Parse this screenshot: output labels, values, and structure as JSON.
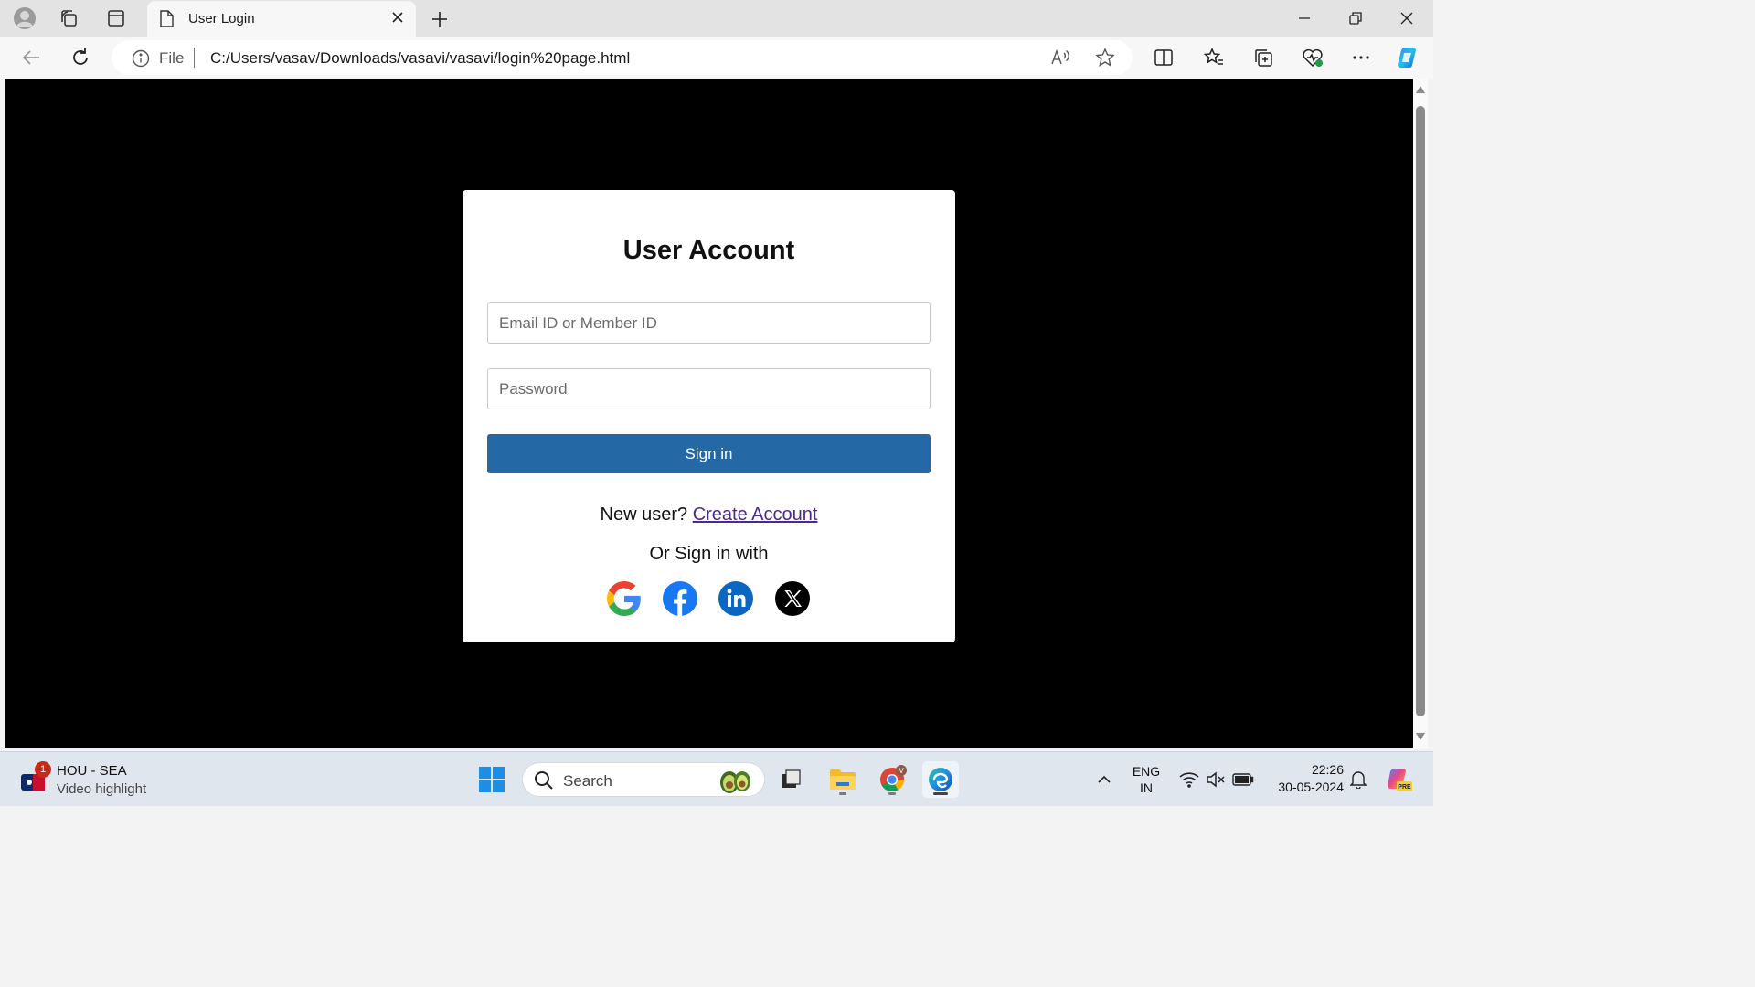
{
  "browser": {
    "tab": {
      "title": "User Login"
    },
    "address": {
      "scheme": "File",
      "url": "C:/Users/vasav/Downloads/vasavi/vasavi/login%20page.html"
    }
  },
  "login": {
    "title": "User Account",
    "email_placeholder": "Email ID or Member ID",
    "password_placeholder": "Password",
    "signin_label": "Sign in",
    "new_user_text": "New user?",
    "create_account_link": "Create Account",
    "or_sign_in_text": "Or Sign in with",
    "social": [
      "google-icon",
      "facebook-icon",
      "linkedin-icon",
      "x-icon"
    ]
  },
  "taskbar": {
    "news": {
      "badge": "1",
      "title": "HOU - SEA",
      "subtitle": "Video highlight"
    },
    "search_label": "Search",
    "language": {
      "line1": "ENG",
      "line2": "IN"
    },
    "clock": {
      "time": "22:26",
      "date": "30-05-2024"
    },
    "chrome_profile": "V",
    "copilot_badge": "PRE"
  },
  "colors": {
    "accent_button": "#2468a6",
    "page_bg": "#000000",
    "card_bg": "#ffffff",
    "link": "#4a2a8a"
  }
}
